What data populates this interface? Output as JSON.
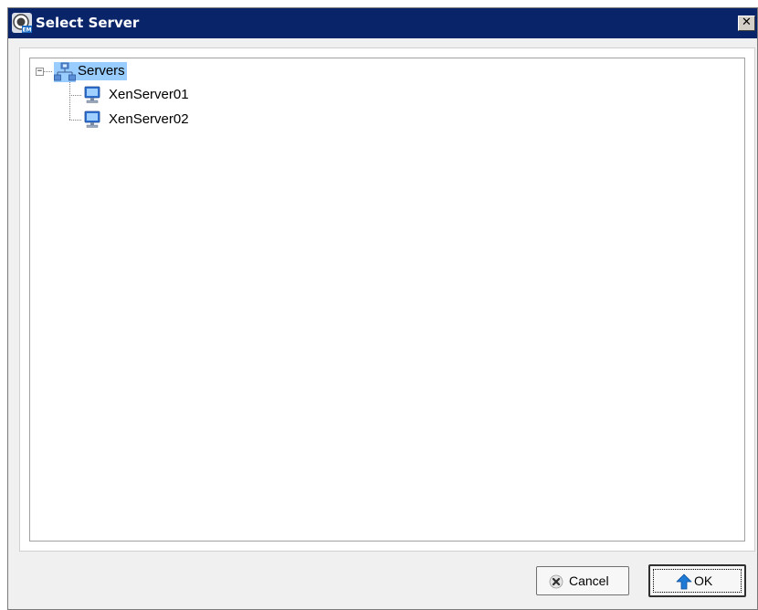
{
  "window": {
    "title": "Select Server",
    "close_label": "✕"
  },
  "tree": {
    "root": {
      "label": "Servers",
      "expanded": true,
      "expander_symbol": "−",
      "icon": "network-servers-icon",
      "selected": true
    },
    "children": [
      {
        "label": "XenServer01",
        "icon": "computer-monitor-icon"
      },
      {
        "label": "XenServer02",
        "icon": "computer-monitor-icon"
      }
    ]
  },
  "buttons": {
    "cancel": {
      "label": "Cancel",
      "icon": "cancel-x-icon"
    },
    "ok": {
      "label": "OK",
      "icon": "up-arrow-icon",
      "default": true
    }
  },
  "colors": {
    "titlebar": "#0a246a",
    "selection": "#99ccff"
  }
}
